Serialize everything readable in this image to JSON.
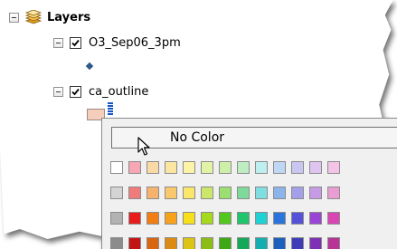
{
  "toc": {
    "root": {
      "label": "Layers",
      "expander": "collapse-minus",
      "icon": "layers-stack-icon"
    },
    "layers": [
      {
        "label": "O3_Sep06_3pm",
        "checked": true,
        "expander": "collapse-minus",
        "symbol": "blue-diamond-point-symbol"
      },
      {
        "label": "ca_outline",
        "checked": true,
        "expander": "collapse-minus",
        "symbol": "peach-polygon-symbol"
      }
    ]
  },
  "colors": {
    "point_symbol": "#2e5a8a",
    "polygon_fill": "#f4cdbb",
    "dropdown_arrow": "#1a55c4"
  },
  "palette": {
    "no_color_label": "No Color",
    "rows": [
      [
        "#ffffff",
        "#f7a7b4",
        "#fbd9a5",
        "#fbe6a1",
        "#fbf3a6",
        "#e2f3a6",
        "#cdf0a8",
        "#bdedc0",
        "#bdeff0",
        "#bfd7f4",
        "#c9c6f2",
        "#dfc4f0",
        "#f3c4e6"
      ],
      [
        "#d4d4d4",
        "#f07b7b",
        "#f7b36d",
        "#f9c86c",
        "#f9e66b",
        "#cbe66b",
        "#9bde71",
        "#7fd99b",
        "#7fdfe0",
        "#8bb4ea",
        "#a3a0e8",
        "#c79ae6",
        "#ea9dd3"
      ],
      [
        "#b2b2b2",
        "#e81c1c",
        "#f37d12",
        "#f7a21a",
        "#f7e01b",
        "#a6d81c",
        "#52c81e",
        "#1fc56a",
        "#1fd1d2",
        "#2a75dd",
        "#5551d8",
        "#9a44d6",
        "#d946b4"
      ],
      [
        "#8c8c8c",
        "#c21414",
        "#d96510",
        "#dd8a14",
        "#ddc414",
        "#8cbd14",
        "#3ea714",
        "#14a858",
        "#14aeb0",
        "#1c5fbd",
        "#3f3cb8",
        "#7f31b5",
        "#b83497"
      ]
    ]
  },
  "cursor": {
    "icon": "arrow-cursor-icon"
  }
}
